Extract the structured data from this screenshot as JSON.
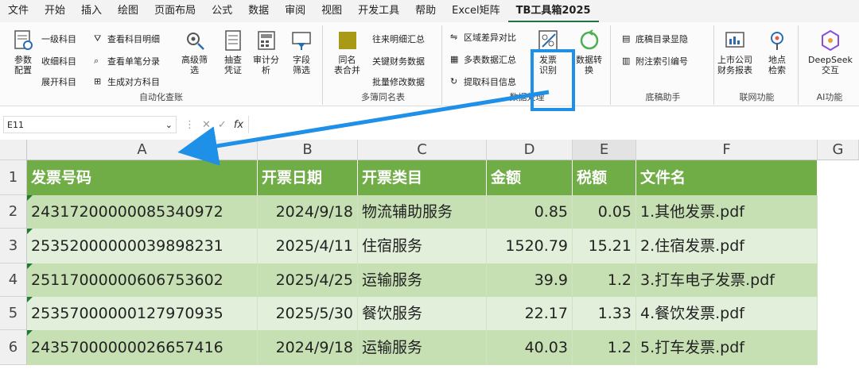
{
  "menu": {
    "tabs": [
      "文件",
      "开始",
      "插入",
      "绘图",
      "页面布局",
      "公式",
      "数据",
      "审阅",
      "视图",
      "开发工具",
      "帮助",
      "Excel矩阵",
      "TB工具箱2025"
    ]
  },
  "ribbon": {
    "auto_group": {
      "label": "自动化查账",
      "params_btn": "参数\n配置",
      "level1": "一级科目",
      "level_end": "收细科目",
      "expand": "展开科目",
      "view_detail": "查看科目明细",
      "view_voucher": "查看单笔分录",
      "gen_opposite": "生成对方科目",
      "adv_filter": "高级筛\n选",
      "check_voucher": "抽查\n凭证",
      "audit_analysis": "审计分\n析",
      "field_filter": "字段\n筛选"
    },
    "merge_group": {
      "label": "多簿同名表",
      "same_name": "同名\n表合并",
      "ar_summary": "往来明细汇总",
      "key_data": "关键财务数据",
      "batch_modify": "批量修改数据"
    },
    "data_group": {
      "label": "数据处理",
      "region_diff": "区域差异对比",
      "multi_table": "多表数据汇总",
      "extract_subject": "提取科目信息",
      "invoice_recog": "发票\n识别",
      "data_convert": "数据转\n换"
    },
    "draft_group": {
      "label": "底稿助手",
      "draft_dir": "底稿目录显隐",
      "note_index": "附注索引编号"
    },
    "web_group": {
      "label": "联网功能",
      "listed_report": "上市公司\n财务报表",
      "location": "地点\n检索"
    },
    "ai_group": {
      "label": "AI功能",
      "deepseek": "DeepSeek\n交互"
    }
  },
  "formula_bar": {
    "name_box": "E11",
    "fx": "fx",
    "value": ""
  },
  "sheet": {
    "columns": [
      "A",
      "B",
      "C",
      "D",
      "E",
      "F",
      "G"
    ],
    "rows": [
      "1",
      "2",
      "3",
      "4",
      "5",
      "6"
    ],
    "headers": [
      "发票号码",
      "开票日期",
      "开票类目",
      "金额",
      "税额",
      "文件名"
    ],
    "data": [
      [
        "24317200000085340972",
        "2024/9/18",
        "物流辅助服务",
        "0.85",
        "0.05",
        "1.其他发票.pdf"
      ],
      [
        "25352000000039898231",
        "2025/4/11",
        "住宿服务",
        "1520.79",
        "15.21",
        "2.住宿发票.pdf"
      ],
      [
        "25117000000606753602",
        "2025/4/25",
        "运输服务",
        "39.9",
        "1.2",
        "3.打车电子发票.pdf"
      ],
      [
        "25357000000127970935",
        "2025/5/30",
        "餐饮服务",
        "22.17",
        "1.33",
        "4.餐饮发票.pdf"
      ],
      [
        "24357000000026657416",
        "2024/9/18",
        "运输服务",
        "40.03",
        "1.2",
        "5.打车发票.pdf"
      ]
    ]
  },
  "colors": {
    "header_green": "#70ad47",
    "row_dark": "#c6e0b4",
    "row_light": "#e2efda",
    "highlight_blue": "#1e90e8"
  }
}
